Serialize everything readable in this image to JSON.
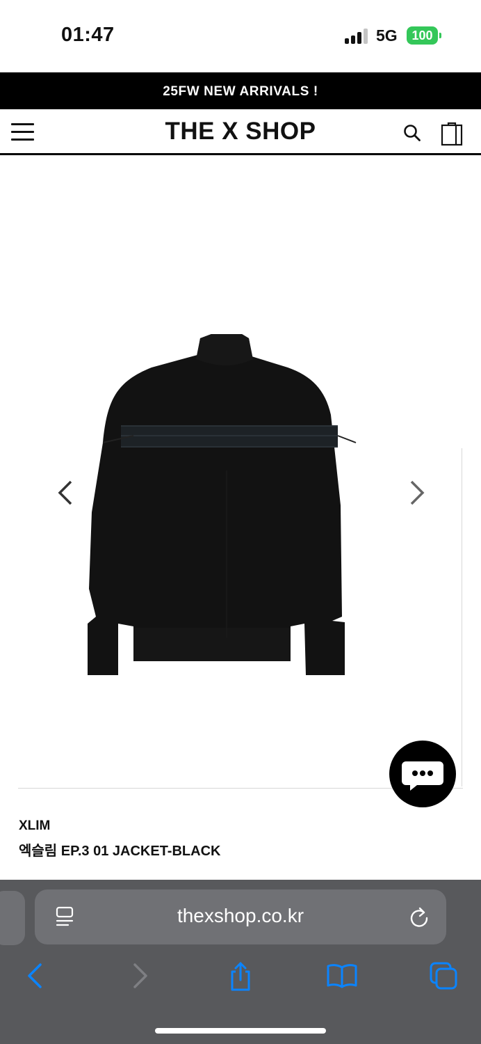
{
  "status_bar": {
    "time": "01:47",
    "network": "5G",
    "battery": "100"
  },
  "announcement": "25FW NEW ARRIVALS !",
  "header": {
    "logo": "THE X SHOP"
  },
  "product": {
    "brand": "XLIM",
    "name": "엑슬림 EP.3 01 JACKET-BLACK"
  },
  "browser": {
    "url": "thexshop.co.kr"
  },
  "colors": {
    "accent": "#0a84ff",
    "battery": "#34c759",
    "announcement_bg": "#000000",
    "browser_bg": "#58595c"
  }
}
